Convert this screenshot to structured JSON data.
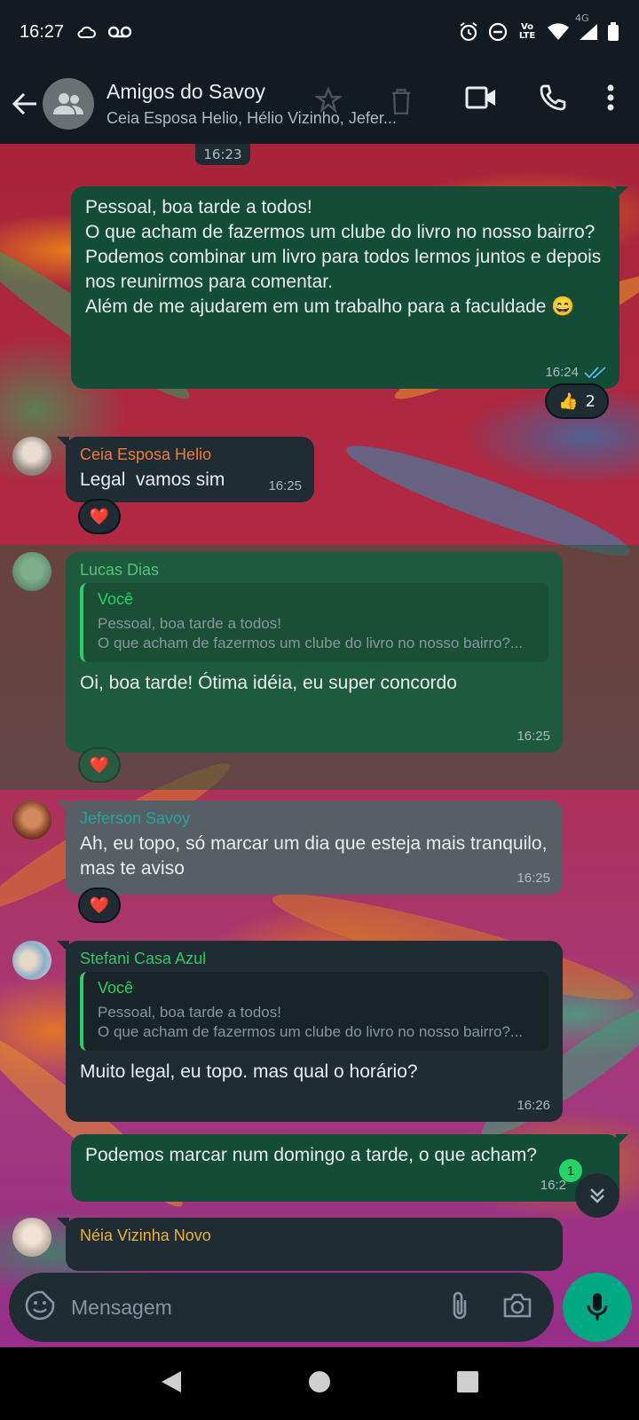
{
  "status_bar": {
    "time": "16:27",
    "network": "4G",
    "volte": "Vo LTE"
  },
  "header": {
    "title": "Amigos do Savoy",
    "subtitle": "Ceia Esposa Helio, Hélio Vizinho, Jefer..."
  },
  "date_chip": "16:23",
  "messages": [
    {
      "type": "out",
      "text": "Pessoal, boa tarde a todos!\nO que acham de fazermos um clube do livro no nosso bairro?\nPodemos combinar um livro para todos lermos juntos e depois nos reunirmos para comentar.\nAlém de me ajudarem em um trabalho para a faculdade 😄",
      "time": "16:24",
      "reaction": {
        "emoji": "👍",
        "count": "2"
      }
    },
    {
      "type": "in",
      "sender": "Ceia Esposa Helio",
      "sender_color": "#f07a3e",
      "text": "Legal  vamos sim",
      "time": "16:25",
      "reaction": {
        "emoji": "❤️"
      }
    },
    {
      "type": "in",
      "sender": "Lucas Dias",
      "sender_color": "#57c27a",
      "quote_author": "Você",
      "quote_text": "Pessoal, boa tarde a todos!\nO que acham de fazermos um clube do livro no nosso bairro?...",
      "text": "Oi, boa tarde! Ótima idéia, eu super concordo",
      "time": "16:25",
      "reaction": {
        "emoji": "❤️"
      }
    },
    {
      "type": "in",
      "sender": "Jeferson Savoy",
      "sender_color": "#1fa7a0",
      "text": "Ah, eu topo, só marcar um dia que esteja mais tranquilo, mas te aviso",
      "time": "16:25",
      "reaction": {
        "emoji": "❤️"
      }
    },
    {
      "type": "in",
      "sender": "Stefani Casa Azul",
      "sender_color": "#35c46a",
      "quote_author": "Você",
      "quote_text": "Pessoal, boa tarde a todos!\nO que acham de fazermos um clube do livro no nosso bairro?...",
      "text": "Muito legal, eu topo. mas qual o horário?",
      "time": "16:26"
    },
    {
      "type": "out",
      "text": "Podemos marcar num domingo a tarde, o que acham?",
      "time": "16:2"
    },
    {
      "type": "in",
      "sender": "Néia Vizinha Novo",
      "sender_color": "#e6b43a"
    }
  ],
  "unread_count": "1",
  "input": {
    "placeholder": "Mensagem"
  },
  "colors": {
    "accent": "#00a884",
    "bubble_out": "#144d37",
    "bubble_in": "#1f2c33",
    "header": "#111b21"
  }
}
